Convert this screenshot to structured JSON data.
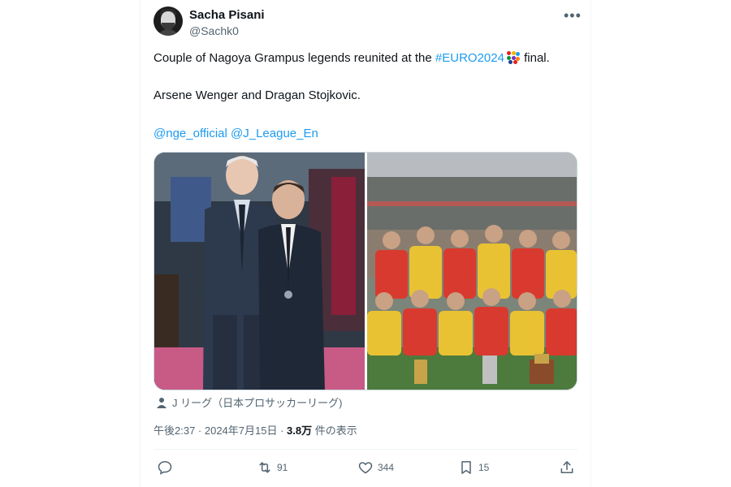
{
  "author": {
    "display_name": "Sacha Pisani",
    "handle": "@Sachk0",
    "avatar_icon": "user-avatar"
  },
  "more_icon": "more-options-icon",
  "body": {
    "line1_prefix": "Couple of Nagoya Grampus legends reunited at the ",
    "hashtag": "#EURO2024",
    "line1_suffix": " final.",
    "line2": "Arsene Wenger and Dragan Stojkovic.",
    "mention1": "@nge_official",
    "mention2": "@J_League_En"
  },
  "media": {
    "caption": "J リーグ（日本プロサッカーリーグ)",
    "caption_icon": "person-icon"
  },
  "meta": {
    "time": "午後2:37 · 2024年7月15日 · ",
    "views_count": "3.8万",
    "views_label": " 件の表示"
  },
  "actions": {
    "reply": {
      "icon": "reply-icon",
      "count": ""
    },
    "retweet": {
      "icon": "retweet-icon",
      "count": "91"
    },
    "like": {
      "icon": "like-icon",
      "count": "344"
    },
    "bookmark": {
      "icon": "bookmark-icon",
      "count": "15"
    },
    "share": {
      "icon": "share-icon",
      "count": ""
    }
  },
  "colors": {
    "link": "#1d9bf0",
    "secondary_text": "#536471",
    "primary_text": "#0f1419"
  }
}
